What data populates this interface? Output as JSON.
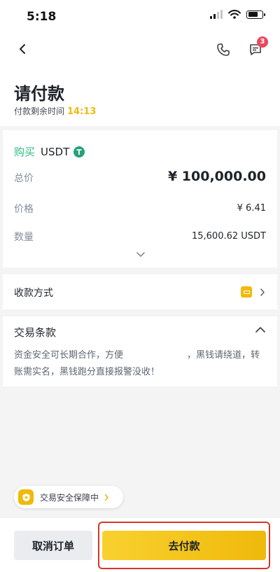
{
  "status_bar": {
    "time": "5:18"
  },
  "header": {
    "message_badge": "3",
    "title": "请付款",
    "timer_label": "付款剩余时间",
    "timer_value": "14:13"
  },
  "order": {
    "side": "购买",
    "asset": "USDT",
    "rows": [
      {
        "label": "总价",
        "value": "¥ 100,000.00"
      },
      {
        "label": "价格",
        "value": "¥ 6.41"
      },
      {
        "label": "数量",
        "value": "15,600.62 USDT"
      }
    ]
  },
  "payment_method": {
    "label": "收款方式"
  },
  "terms": {
    "title": "交易条款",
    "text": "资金安全可长期合作，方便　　　　　　　，黑钱请绕道，转账需实名，黑钱跑分直接报警没收！"
  },
  "safety": {
    "label": "交易安全保障中"
  },
  "actions": {
    "cancel_label": "取消订单",
    "pay_label": "去付款"
  },
  "colors": {
    "brand_yellow": "#f0b90b",
    "buy_green": "#2ebd85",
    "badge_red": "#e8495f",
    "highlight_red": "#d6362b"
  },
  "icons": [
    "back-arrow-icon",
    "phone-icon",
    "chat-icon",
    "tether-icon",
    "chevron-down-icon",
    "wallet-icon",
    "chevron-right-icon",
    "chevron-up-icon",
    "shield-icon"
  ]
}
